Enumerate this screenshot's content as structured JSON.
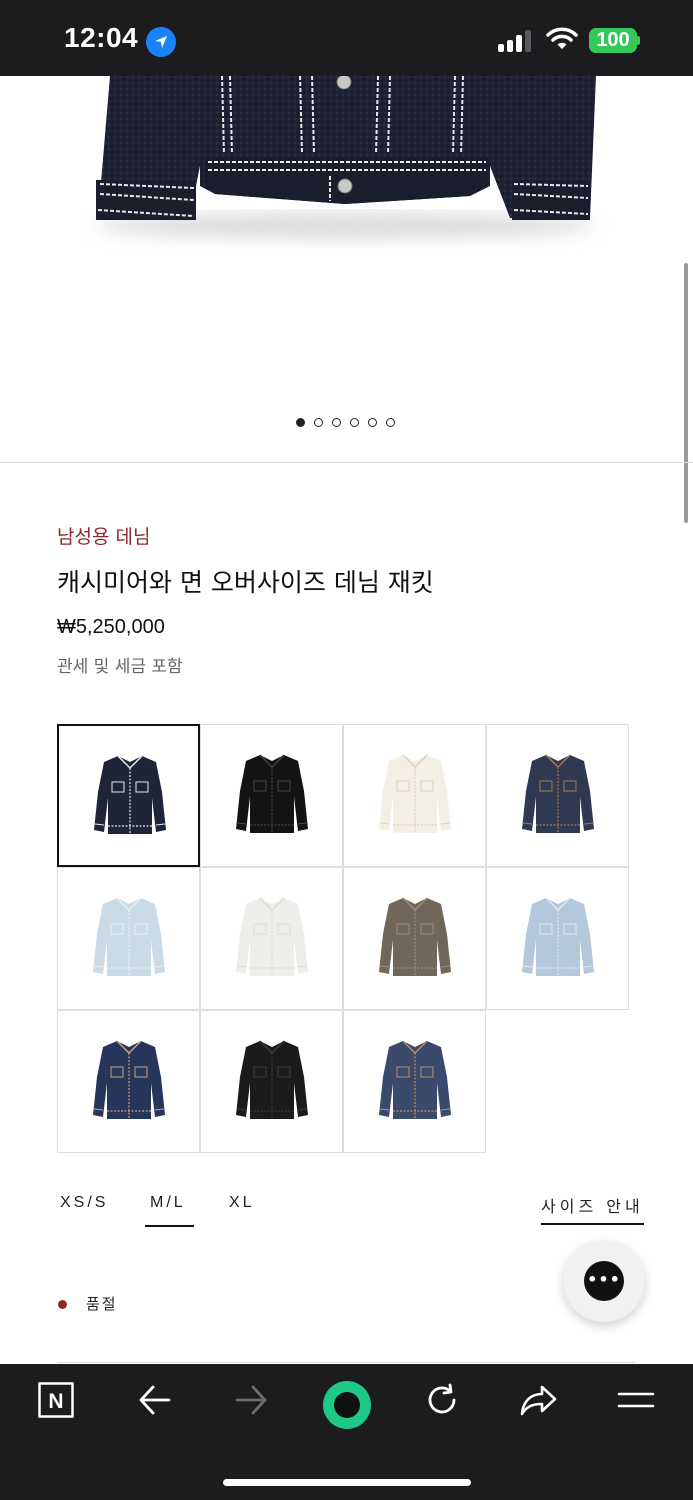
{
  "status_bar": {
    "time": "12:04",
    "battery": "100",
    "icons": [
      "location-arrow-icon",
      "cellular-signal-icon",
      "wifi-icon",
      "battery-icon"
    ]
  },
  "carousel": {
    "total_images": 6,
    "active_index": 0
  },
  "product": {
    "category": "남성용 데님",
    "title": "캐시미어와 면 오버사이즈 데님 재킷",
    "price": "₩5,250,000",
    "tax_note": "관세 및 세금 포함"
  },
  "swatches": [
    {
      "color": "#1f2438",
      "stitch": "#e8e8e8",
      "selected": true
    },
    {
      "color": "#141414",
      "stitch": "#444444",
      "selected": false
    },
    {
      "color": "#f3efe4",
      "stitch": "#d9d2c0",
      "selected": false
    },
    {
      "color": "#2f3a52",
      "stitch": "#a8784a",
      "selected": false
    },
    {
      "color": "#c9dbe6",
      "stitch": "#e9f0f4",
      "selected": false
    },
    {
      "color": "#eceeea",
      "stitch": "#d8dbd5",
      "selected": false
    },
    {
      "color": "#716657",
      "stitch": "#9a8e7e",
      "selected": false
    },
    {
      "color": "#b4c8dc",
      "stitch": "#dfe8f1",
      "selected": false
    },
    {
      "color": "#26365a",
      "stitch": "#c9a27a",
      "selected": false
    },
    {
      "color": "#1b1b1b",
      "stitch": "#3a3a3a",
      "selected": false
    },
    {
      "color": "#3a4a6c",
      "stitch": "#c48c5c",
      "selected": false
    }
  ],
  "sizes": {
    "options": [
      "XS/S",
      "M/L",
      "XL"
    ],
    "selected": "M/L",
    "guide_label": "사이즈 안내"
  },
  "availability": {
    "label": "품절",
    "dot_color": "#8b2a2a"
  },
  "chat": {
    "icon": "chat-bubble-icon",
    "glyph": "•••"
  },
  "browser_bar": {
    "icons": [
      "naver-n-icon",
      "back-arrow-icon",
      "forward-arrow-icon",
      "green-dot-home-icon",
      "reload-icon",
      "share-icon",
      "menu-icon"
    ],
    "n_logo": "N",
    "accent": "#1ec886"
  }
}
